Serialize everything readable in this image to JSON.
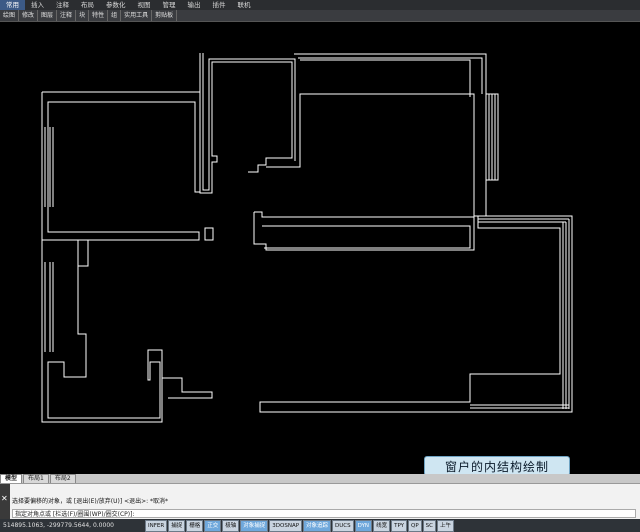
{
  "ribbon": {
    "tabs": [
      "常用",
      "插入",
      "注释",
      "布局",
      "参数化",
      "视图",
      "管理",
      "输出",
      "插件",
      "联机"
    ],
    "panels": [
      "绘图",
      "修改",
      "图层",
      "注释",
      "块",
      "特性",
      "组",
      "实用工具",
      "剪贴板"
    ]
  },
  "caption": "窗户的内结构绘制",
  "layout_tabs": [
    "模型",
    "布局1",
    "布局2"
  ],
  "command": {
    "line1": "选择要偏移的对象，或 [退出(E)/放弃(U)] <退出>:  *取消*",
    "line2": "指定对角点或 [栏选(F)/圈围(WP)/圈交(CP)]:"
  },
  "status": {
    "coords": "514895.1063, -299779.5644, 0.0000",
    "buttons": [
      "INFER",
      "捕捉",
      "栅格",
      "正交",
      "极轴",
      "对象捕捉",
      "3DOSNAP",
      "对象追踪",
      "DUCS",
      "DYN",
      "线宽",
      "TPY",
      "QP",
      "SC",
      "上午"
    ]
  },
  "colors": {
    "canvas": "#000000",
    "lines": "#ffffff",
    "caption_bg": "#cfe6f2"
  }
}
